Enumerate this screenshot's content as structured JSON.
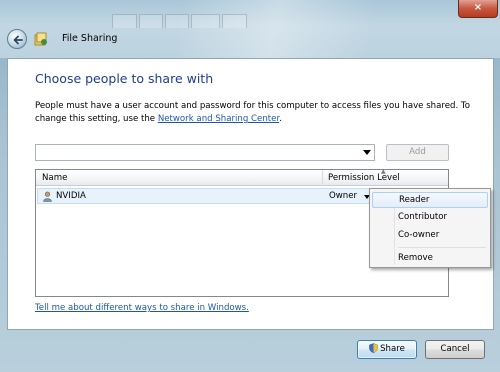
{
  "window": {
    "title": "File Sharing",
    "close_label": "×"
  },
  "main": {
    "heading": "Choose people to share with",
    "description": "People must have a user account and password for this computer to access files you have shared.  To change this setting, use the ",
    "description_link": "Network and Sharing Center",
    "description_end": ".",
    "add_button": "Add",
    "name_input_value": "",
    "columns": {
      "name": "Name",
      "permission": "Permission Level"
    },
    "rows": [
      {
        "name": "NVIDIA",
        "permission": "Owner"
      }
    ],
    "help_link": "Tell me about different ways to share in Windows."
  },
  "context_menu": {
    "items": [
      "Reader",
      "Contributor",
      "Co-owner",
      "Remove"
    ],
    "highlighted": "Reader"
  },
  "footer": {
    "share_button": "Share",
    "cancel_button": "Cancel"
  },
  "icons": {
    "back": "back-arrow-icon",
    "app": "file-sharing-icon",
    "user": "user-icon",
    "shield": "uac-shield-icon"
  }
}
